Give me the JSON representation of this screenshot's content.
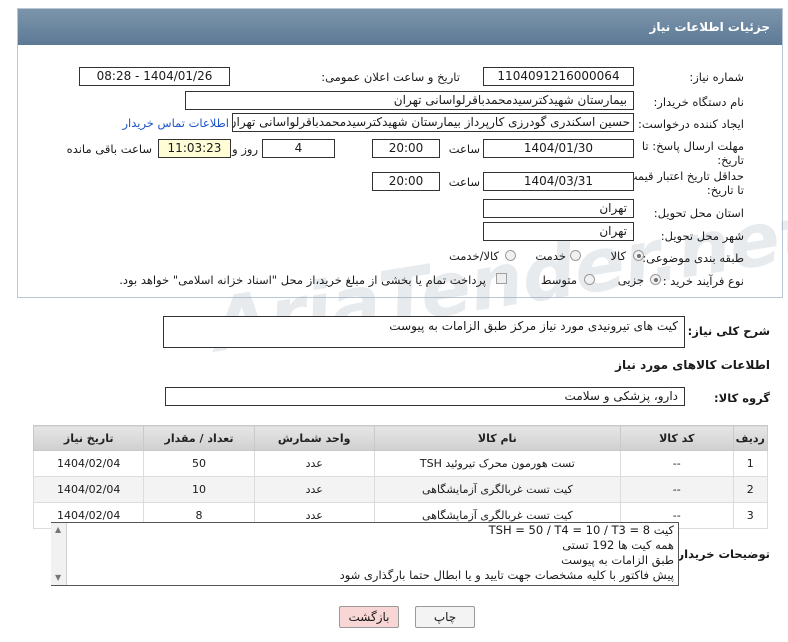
{
  "header": {
    "title": "جزئیات اطلاعات نیاز"
  },
  "form": {
    "need_number_label": "شماره نیاز:",
    "need_number": "1104091216000064",
    "announce_label": "تاریخ و ساعت اعلان عمومی:",
    "announce_value": "1404/01/26 - 08:28",
    "buyer_org_label": "نام دستگاه خریدار:",
    "buyer_org": "بیمارستان شهیدکترسیدمحمدباقرلواسانی تهران",
    "requester_label": "ایجاد کننده درخواست:",
    "requester": "حسین اسکندری گودرزی کارپرداز بیمارستان شهیدکترسیدمحمدباقرلواسانی تهران",
    "contact_link": "اطلاعات تماس خریدار",
    "deadline_label_1": "مهلت ارسال پاسخ: تا",
    "deadline_label_2": "تاریخ:",
    "deadline_date": "1404/01/30",
    "time_label": "ساعت",
    "deadline_time": "20:00",
    "days_value": "4",
    "days_label": "روز و",
    "remaining_time": "11:03:23",
    "remaining_label": "ساعت باقی مانده",
    "validity_label_1": "حداقل تاریخ اعتبار قیمت:",
    "validity_label_2": "تا تاریخ:",
    "validity_date": "1404/03/31",
    "validity_time": "20:00",
    "province_label": "استان محل تحویل:",
    "province": "تهران",
    "city_label": "شهر محل تحویل:",
    "city": "تهران",
    "category_label": "طبقه بندی موضوعی:",
    "category_options": [
      "کالا",
      "خدمت",
      "کالا/خدمت"
    ],
    "category_selected": "کالا",
    "process_label": "نوع فرآیند خرید :",
    "process_options": [
      "جزیی",
      "متوسط"
    ],
    "process_selected": "جزیی",
    "payment_note": "پرداخت تمام یا بخشی از مبلغ خرید،از محل \"اسناد خزانه اسلامی\" خواهد بود."
  },
  "description": {
    "label": "شرح کلی نیاز:",
    "value": "کیت های تیرونیدی مورد نیاز مرکز طبق الزامات به پیوست"
  },
  "items_section": {
    "title": "اطلاعات کالاهای مورد نیاز",
    "group_label": "گروه کالا:",
    "group_value": "دارو، پزشکی و سلامت",
    "columns": [
      "ردیف",
      "کد کالا",
      "نام کالا",
      "واحد شمارش",
      "تعداد / مقدار",
      "تاریخ نیاز"
    ],
    "rows": [
      [
        "1",
        "--",
        "تست هورمون محرک تیروئید TSH",
        "عدد",
        "50",
        "1404/02/04"
      ],
      [
        "2",
        "--",
        "کیت تست غربالگری آزمایشگاهی",
        "عدد",
        "10",
        "1404/02/04"
      ],
      [
        "3",
        "--",
        "کیت تست غربالگری آزمایشگاهی",
        "عدد",
        "8",
        "1404/02/04"
      ]
    ]
  },
  "buyer_notes": {
    "label": "توضیحات خریدار:",
    "lines": [
      "کیت TSH = 50 / T4 = 10 / T3 = 8",
      "همه کیت ها 192 تستی",
      "طبق الزامات به پیوست",
      "پیش فاکتور با کلیه مشخصات جهت تایید و یا ابطال حتما بارگذاری شود"
    ]
  },
  "buttons": {
    "print": "چاپ",
    "back": "بازگشت"
  },
  "watermark": "AriaTender.net",
  "colors": {
    "header_bg": "#6a849d",
    "link": "#1c54c7",
    "back_button_bg": "#f9d6d6"
  }
}
